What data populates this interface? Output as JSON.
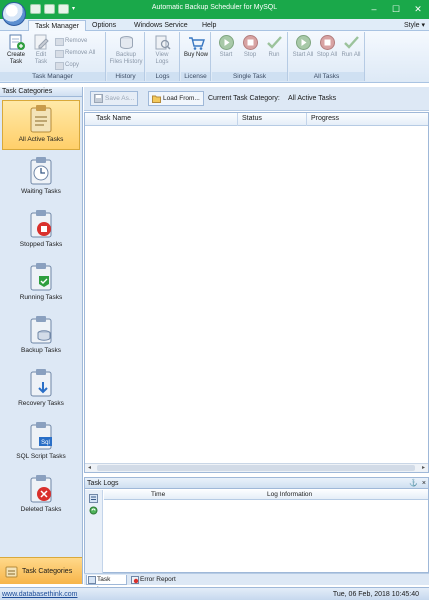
{
  "window": {
    "title": "Automatic Backup Scheduler for MySQL"
  },
  "ribbon": {
    "tabs": [
      "Task Manager",
      "Options",
      "Windows Service",
      "Help"
    ],
    "style_label": "Style",
    "groups": {
      "task_manager": {
        "label": "Task Manager",
        "create_task": "Create Task",
        "edit_task": "Edit Task",
        "remove": "Remove",
        "remove_all": "Remove All",
        "copy": "Copy"
      },
      "history": {
        "label": "History",
        "backup_files_history": "Backup Files History"
      },
      "logs": {
        "label": "Logs",
        "view_logs": "View Logs"
      },
      "license": {
        "label": "License",
        "buy_now": "Buy Now"
      },
      "single_task": {
        "label": "Single Task",
        "start": "Start",
        "stop": "Stop",
        "run": "Run"
      },
      "all_tasks": {
        "label": "All Tasks",
        "start_all": "Start All",
        "stop_all": "Stop All",
        "run_all": "Run All"
      }
    }
  },
  "sidebar": {
    "header": "Task Categories",
    "items": [
      {
        "label": "All Active Tasks",
        "icon": "all-active-tasks-icon",
        "active": true
      },
      {
        "label": "Waiting Tasks",
        "icon": "waiting-tasks-icon"
      },
      {
        "label": "Stopped Tasks",
        "icon": "stopped-tasks-icon"
      },
      {
        "label": "Running Tasks",
        "icon": "running-tasks-icon"
      },
      {
        "label": "Backup Tasks",
        "icon": "backup-tasks-icon"
      },
      {
        "label": "Recovery Tasks",
        "icon": "recovery-tasks-icon"
      },
      {
        "label": "SQL Script Tasks",
        "icon": "sql-script-tasks-icon"
      },
      {
        "label": "Deleted Tasks",
        "icon": "deleted-tasks-icon"
      }
    ],
    "bottom_button": "Task Categories"
  },
  "toolbar": {
    "save_as": "Save As...",
    "load_from": "Load From...",
    "current_category_label": "Current Task Category:",
    "current_category_value": "All Active Tasks"
  },
  "task_grid": {
    "columns": [
      "Task Name",
      "Status",
      "Progress"
    ],
    "rows": []
  },
  "logs": {
    "title": "Task Logs",
    "pin": "⚓",
    "close": "×",
    "columns": [
      "Time",
      "Log Information"
    ],
    "rows": []
  },
  "bottom_tabs": [
    "Task Logs",
    "Error Report"
  ],
  "status_bar": {
    "link": "www.databasethink.com",
    "datetime": "Tue, 06 Feb, 2018 10:45:40"
  },
  "colors": {
    "title_bar": "#1aa84a",
    "active_category": "#ffcf6a",
    "panel": "#dde8f5"
  }
}
